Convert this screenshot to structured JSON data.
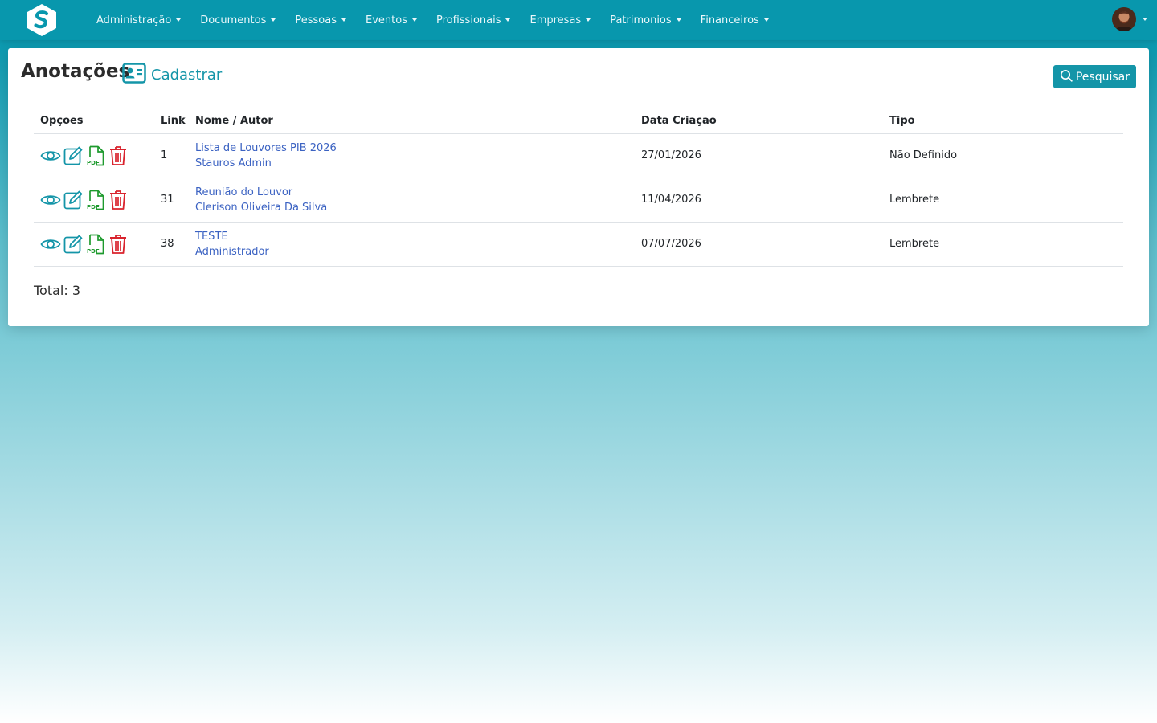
{
  "nav": {
    "menu": [
      {
        "label": "Administração"
      },
      {
        "label": "Documentos"
      },
      {
        "label": "Pessoas"
      },
      {
        "label": "Eventos"
      },
      {
        "label": "Profissionais"
      },
      {
        "label": "Empresas"
      },
      {
        "label": "Patrimonios"
      },
      {
        "label": "Financeiros"
      }
    ]
  },
  "page": {
    "title": "Anotações",
    "create_label": "Cadastrar",
    "search_label": "Pesquisar"
  },
  "table": {
    "headers": {
      "options": "Opções",
      "link": "Link",
      "name_author": "Nome / Autor",
      "created": "Data Criação",
      "type": "Tipo"
    },
    "rows": [
      {
        "link": "1",
        "name": "Lista de Louvores PIB 2026",
        "author": "Stauros Admin",
        "created": "27/01/2026",
        "type": "Não Definido"
      },
      {
        "link": "31",
        "name": "Reunião do Louvor",
        "author": "Clerison Oliveira Da Silva",
        "created": "11/04/2026",
        "type": "Lembrete"
      },
      {
        "link": "38",
        "name": "TESTE",
        "author": "Administrador",
        "created": "07/07/2026",
        "type": "Lembrete"
      }
    ]
  },
  "total_label": "Total: 3",
  "colors": {
    "navbar": "#0897ad",
    "accent": "#1495a8",
    "link": "#3b62c2",
    "pdf_icon": "#1e9a2e",
    "delete_icon": "#d9232d"
  },
  "icons": [
    "logo-icon",
    "eye-icon",
    "edit-icon",
    "pdf-icon",
    "trash-icon",
    "id-card-icon",
    "search-icon",
    "avatar"
  ]
}
